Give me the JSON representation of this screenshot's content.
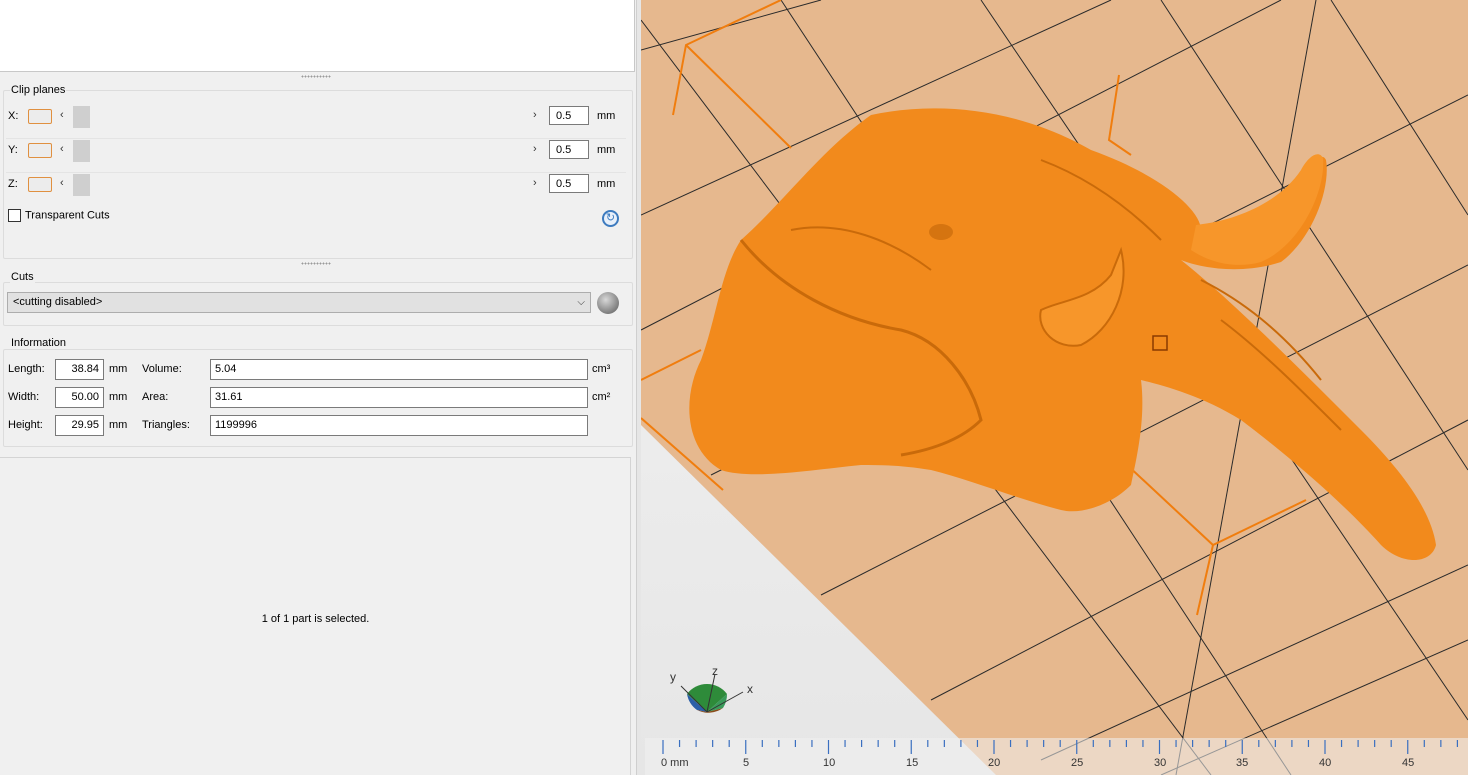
{
  "clip_planes": {
    "title": "Clip planes",
    "rows": [
      {
        "axis": "X:",
        "value": "0.5",
        "unit": "mm"
      },
      {
        "axis": "Y:",
        "value": "0.5",
        "unit": "mm"
      },
      {
        "axis": "Z:",
        "value": "0.5",
        "unit": "mm"
      }
    ],
    "transparent_cuts_label": "Transparent Cuts"
  },
  "cuts": {
    "title": "Cuts",
    "selected": "<cutting disabled>"
  },
  "information": {
    "title": "Information",
    "length_label": "Length:",
    "length_value": "38.84",
    "length_unit": "mm",
    "width_label": "Width:",
    "width_value": "50.00",
    "width_unit": "mm",
    "height_label": "Height:",
    "height_value": "29.95",
    "height_unit": "mm",
    "volume_label": "Volume:",
    "volume_value": "5.04",
    "volume_unit": "cm³",
    "area_label": "Area:",
    "area_value": "31.61",
    "area_unit": "cm²",
    "triangles_label": "Triangles:",
    "triangles_value": "1199996"
  },
  "status": "1 of 1 part is selected.",
  "viewport": {
    "ruler_labels": [
      "0 mm",
      "5",
      "10",
      "15",
      "20",
      "25",
      "30",
      "35",
      "40",
      "45"
    ],
    "gizmo": {
      "x": "x",
      "y": "y",
      "z": "z"
    },
    "colors": {
      "model": "#f28a1c",
      "bed": "#e6b88e",
      "outline": "#f07d0e"
    }
  }
}
